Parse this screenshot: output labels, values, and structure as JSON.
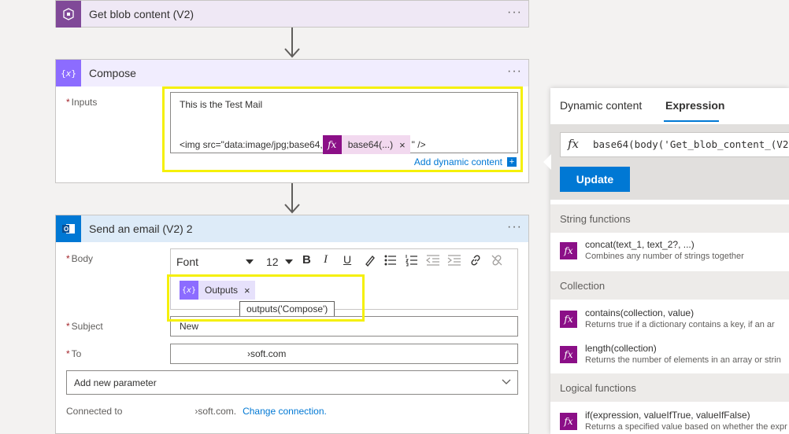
{
  "blob_step": {
    "title": "Get blob content (V2)",
    "menu": "···"
  },
  "compose_step": {
    "title": "Compose",
    "menu": "···",
    "inputs_label": "Inputs",
    "required_mark": "*",
    "line1": "This is the Test Mail",
    "line2_prefix": "<img src=\"data:image/jpg;base64,",
    "token_label": "base64(...)",
    "token_close": "×",
    "line2_suffix": "\" />",
    "add_dynamic": "Add dynamic content",
    "add_icon": "+"
  },
  "email_step": {
    "title": "Send an email (V2) 2",
    "menu": "···",
    "body_label": "Body",
    "font_value": "Font",
    "size_value": "12",
    "outputs_token": "Outputs",
    "outputs_close": "×",
    "tooltip": "outputs('Compose')",
    "subject_label": "Subject",
    "subject_value": "New",
    "to_label": "To",
    "to_value": "›soft.com",
    "add_param": "Add new parameter",
    "connected_label": "Connected to",
    "connected_value": "›soft.com.",
    "change_connection": "Change connection."
  },
  "panel": {
    "tabs": [
      "Dynamic content",
      "Expression"
    ],
    "active_tab": "Expression",
    "expression": "base64(body('Get_blob_content_(V2",
    "update_button": "Update",
    "sections": [
      {
        "title": "String functions",
        "items": [
          {
            "name": "concat(text_1, text_2?, ...)",
            "desc": "Combines any number of strings together"
          }
        ]
      },
      {
        "title": "Collection",
        "items": [
          {
            "name": "contains(collection, value)",
            "desc": "Returns true if a dictionary contains a key, if an ar"
          },
          {
            "name": "length(collection)",
            "desc": "Returns the number of elements in an array or strin"
          }
        ]
      },
      {
        "title": "Logical functions",
        "items": [
          {
            "name": "if(expression, valueIfTrue, valueIfFalse)",
            "desc": "Returns a specified value based on whether the expr"
          }
        ]
      }
    ]
  },
  "colors": {
    "compose_accent": "#8c6cff",
    "blob_accent": "#804998",
    "outlook_accent": "#0078d4",
    "function_icon": "#8b0f87",
    "highlight": "#f5f00a",
    "link": "#0078d4"
  },
  "icons": [
    "blob-storage-icon",
    "compose-icon",
    "outlook-icon",
    "fx-icon",
    "chevron-down-icon",
    "bold-icon",
    "italic-icon",
    "underline-icon",
    "link-icon"
  ]
}
